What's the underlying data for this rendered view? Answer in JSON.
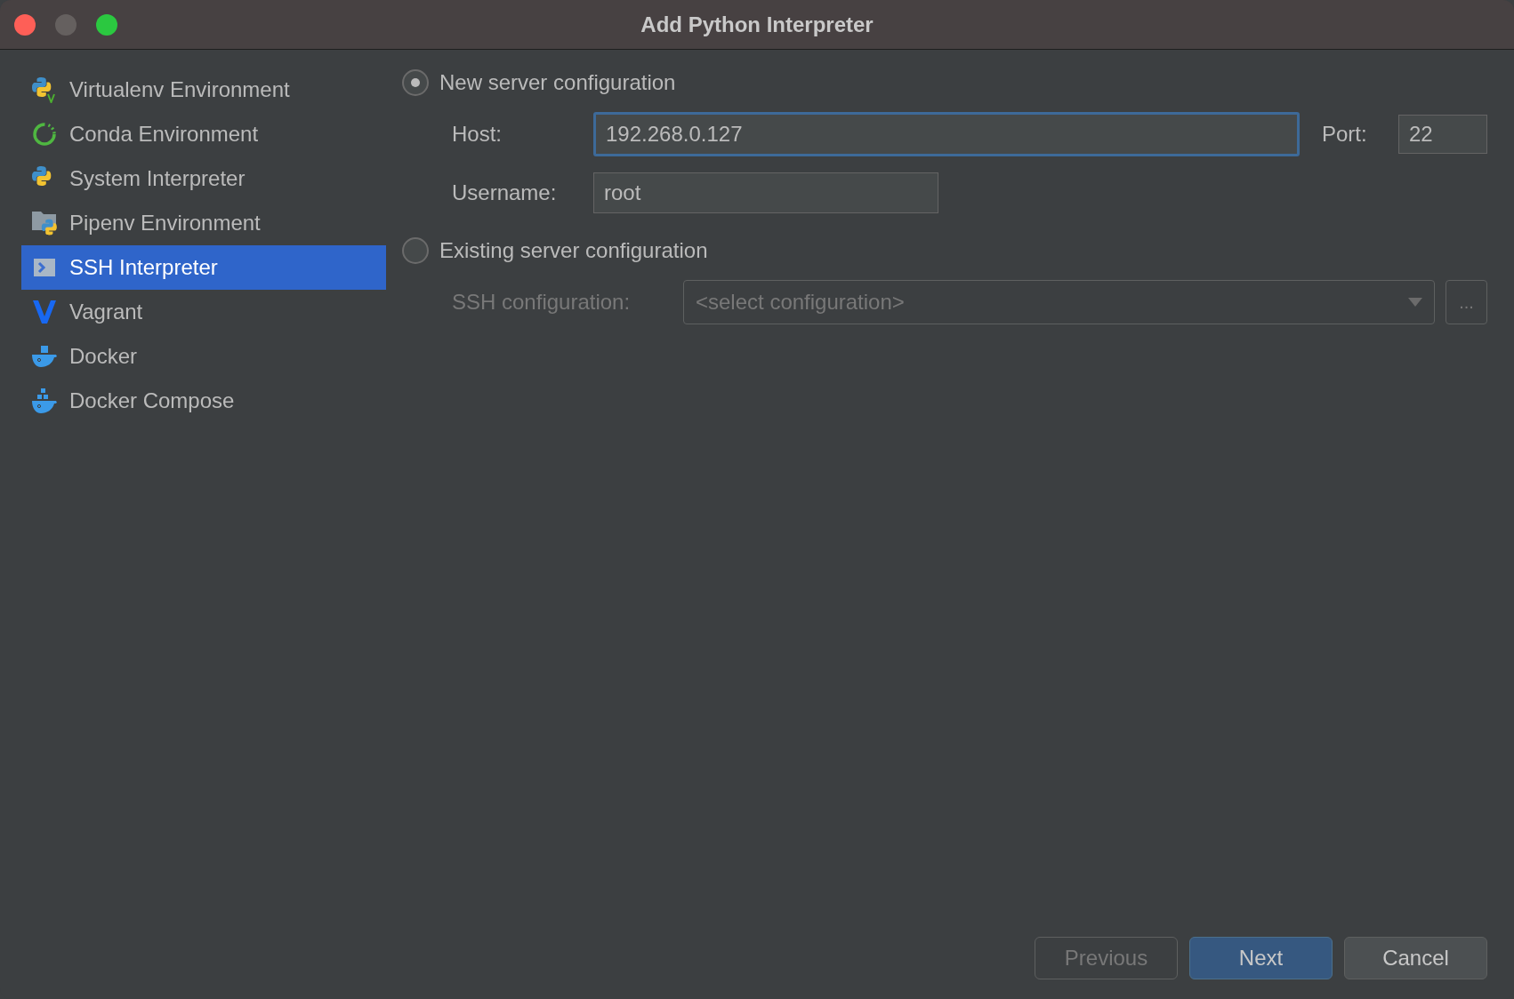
{
  "window": {
    "title": "Add Python Interpreter"
  },
  "sidebar": {
    "items": [
      {
        "label": "Virtualenv Environment",
        "kind": "virtualenv",
        "selected": false
      },
      {
        "label": "Conda Environment",
        "kind": "conda",
        "selected": false
      },
      {
        "label": "System Interpreter",
        "kind": "python",
        "selected": false
      },
      {
        "label": "Pipenv Environment",
        "kind": "pipenv",
        "selected": false
      },
      {
        "label": "SSH Interpreter",
        "kind": "ssh",
        "selected": true
      },
      {
        "label": "Vagrant",
        "kind": "vagrant",
        "selected": false
      },
      {
        "label": "Docker",
        "kind": "docker",
        "selected": false
      },
      {
        "label": "Docker Compose",
        "kind": "compose",
        "selected": false
      }
    ]
  },
  "new_server": {
    "label": "New server configuration",
    "selected": true,
    "host": {
      "label": "Host:",
      "value": "192.268.0.127",
      "focused": true
    },
    "port": {
      "label": "Port:",
      "value": "22",
      "focused": false
    },
    "username": {
      "label": "Username:",
      "value": "root",
      "focused": false
    }
  },
  "existing_server": {
    "label": "Existing server configuration",
    "selected": false,
    "ssh_configuration": {
      "label": "SSH configuration:",
      "placeholder": "<select configuration>",
      "disabled": true,
      "browse": "..."
    }
  },
  "buttons": [
    {
      "label": "Previous",
      "disabled": true,
      "default": false
    },
    {
      "label": "Next",
      "disabled": false,
      "default": true
    },
    {
      "label": "Cancel",
      "disabled": false,
      "default": false
    }
  ]
}
